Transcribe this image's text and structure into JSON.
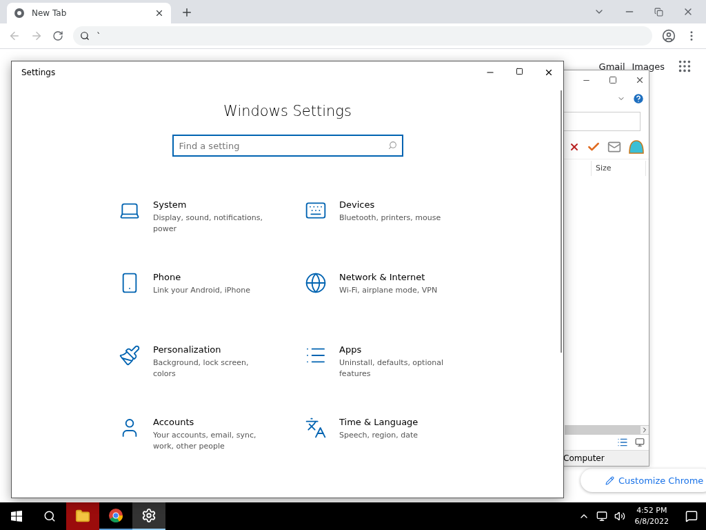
{
  "browser": {
    "tab": {
      "title": "New Tab",
      "selected": true
    },
    "address": {
      "value": "`"
    },
    "links": [
      "Gmail",
      "Images"
    ],
    "customize_button": "Customize Chrome"
  },
  "background_window": {
    "column": "Size",
    "status": "Computer"
  },
  "settings": {
    "title": "Settings",
    "heading": "Windows Settings",
    "search": {
      "placeholder": "Find a setting"
    },
    "categories": [
      {
        "kind": "system",
        "title": "System",
        "description": "Display, sound, notifications, power"
      },
      {
        "kind": "devices",
        "title": "Devices",
        "description": "Bluetooth, printers, mouse"
      },
      {
        "kind": "phone",
        "title": "Phone",
        "description": "Link your Android, iPhone"
      },
      {
        "kind": "network",
        "title": "Network & Internet",
        "description": "Wi-Fi, airplane mode, VPN"
      },
      {
        "kind": "personalization",
        "title": "Personalization",
        "description": "Background, lock screen, colors"
      },
      {
        "kind": "apps",
        "title": "Apps",
        "description": "Uninstall, defaults, optional features"
      },
      {
        "kind": "accounts",
        "title": "Accounts",
        "description": "Your accounts, email, sync, work, other people"
      },
      {
        "kind": "time",
        "title": "Time & Language",
        "description": "Speech, region, date"
      }
    ]
  },
  "taskbar": {
    "apps": [
      {
        "kind": "explorer",
        "attention": true,
        "selected": false
      },
      {
        "kind": "chrome",
        "attention": false,
        "selected": false
      },
      {
        "kind": "settings",
        "attention": false,
        "selected": true
      }
    ],
    "time": "4:52 PM",
    "date": "6/8/2022"
  }
}
